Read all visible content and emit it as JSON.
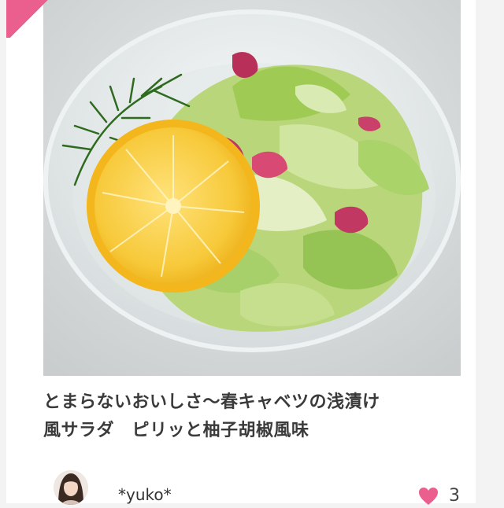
{
  "recipe": {
    "title_line1": "とまらないおいしさ〜春キャベツの浅漬け",
    "title_line2": "風サラダ　ピリッと柚子胡椒風味",
    "image": "cabbage-salad-photo"
  },
  "author": {
    "name": "*yuko*",
    "avatar": "author-avatar"
  },
  "likes": {
    "icon": "heart-icon",
    "count": "3"
  },
  "colors": {
    "accent": "#ea5f8d",
    "heart": "#ea5f8d",
    "title_text": "#3a3a3a"
  }
}
